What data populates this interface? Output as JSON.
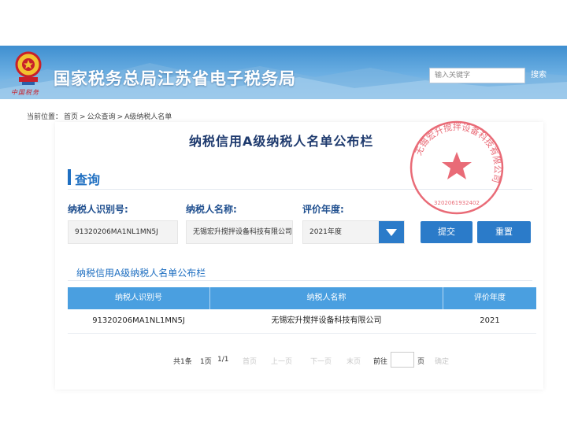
{
  "header": {
    "site_title": "国家税务总局江苏省电子税务局",
    "logo_script": "中国税务",
    "search_placeholder": "输入关键字",
    "search_button": "搜索"
  },
  "breadcrumb": {
    "prefix": "当前位置：",
    "items": [
      "首页",
      "公众查询",
      "A级纳税人名单"
    ],
    "separator": ">"
  },
  "card": {
    "title": "纳税信用A级纳税人名单公布栏"
  },
  "query": {
    "section_title": "查询",
    "fields": [
      {
        "label": "纳税人识别号:",
        "value": "91320206MA1NL1MN5J"
      },
      {
        "label": "纳税人名称:",
        "value": "无锡宏升搅拌设备科技有限公司"
      },
      {
        "label": "评价年度:",
        "value": "2021年度"
      }
    ],
    "submit_button": "提交",
    "reset_button": "重置"
  },
  "results": {
    "subtitle": "纳税信用A级纳税人名单公布栏",
    "columns": [
      "纳税人识别号",
      "纳税人名称",
      "评价年度"
    ],
    "rows": [
      [
        "91320206MA1NL1MN5J",
        "无锡宏升搅拌设备科技有限公司",
        "2021"
      ]
    ]
  },
  "pagination": {
    "total": "共1条",
    "pages": "1页",
    "current": "1/1",
    "first": "首页",
    "prev": "上一页",
    "next": "下一页",
    "last": "末页",
    "goto_prefix": "前往",
    "goto_suffix": "页",
    "confirm": "确定"
  },
  "stamp": {
    "text": "无锡宏升搅拌设备科技有限公司",
    "number": "3202061932402",
    "color": "#e23a4a"
  },
  "colors": {
    "accent": "#2b7bc9",
    "header": "#4a9fe0",
    "title": "#1e3a6e"
  }
}
